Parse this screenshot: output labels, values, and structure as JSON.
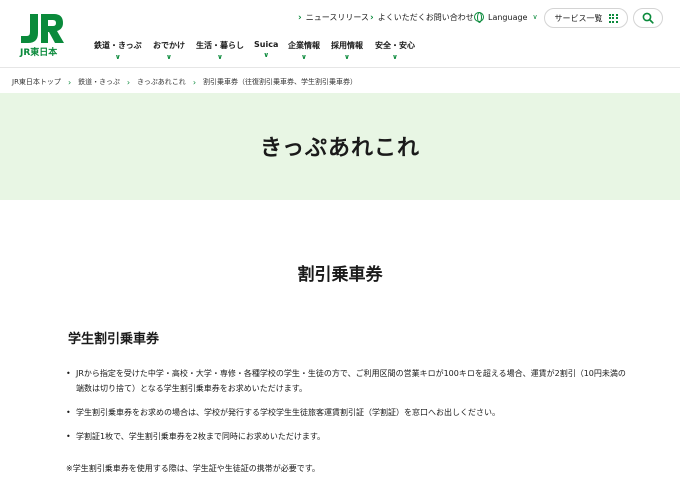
{
  "brand": {
    "logo_text": "JR東日本",
    "color": "#0a8a3b"
  },
  "utility": {
    "news": "ニュースリリース",
    "faq": "よくいただくお問い合わせ",
    "language": "Language",
    "services": "サービス一覧"
  },
  "nav": {
    "items": [
      {
        "label": "鉄道・きっぷ"
      },
      {
        "label": "おでかけ"
      },
      {
        "label": "生活・暮らし"
      },
      {
        "label": "Suica"
      },
      {
        "label": "企業情報"
      },
      {
        "label": "採用情報"
      },
      {
        "label": "安全・安心"
      }
    ]
  },
  "breadcrumb": [
    "JR東日本トップ",
    "鉄道・きっぷ",
    "きっぷあれこれ",
    "割引乗車券（往復割引乗車券、学生割引乗車券）"
  ],
  "hero": {
    "title": "きっぷあれこれ",
    "background": "#e8f6e4"
  },
  "main": {
    "title": "割引乗車券",
    "subtitle": "学生割引乗車券",
    "bullets": [
      "JRから指定を受けた中学・高校・大学・専修・各種学校の学生・生徒の方で、ご利用区間の営業キロが100キロを超える場合、運賃が2割引（10円未満の端数は切り捨て）となる学生割引乗車券をお求めいただけます。",
      "学生割引乗車券をお求めの場合は、学校が発行する学校学生生徒旅客運賃割引証（学割証）を窓口へお出しください。",
      "学割証1枚で、学生割引乗車券を2枚まで同時にお求めいただけます。"
    ],
    "note": "※学生割引乗車券を使用する際は、学生証や生徒証の携帯が必要です。"
  }
}
